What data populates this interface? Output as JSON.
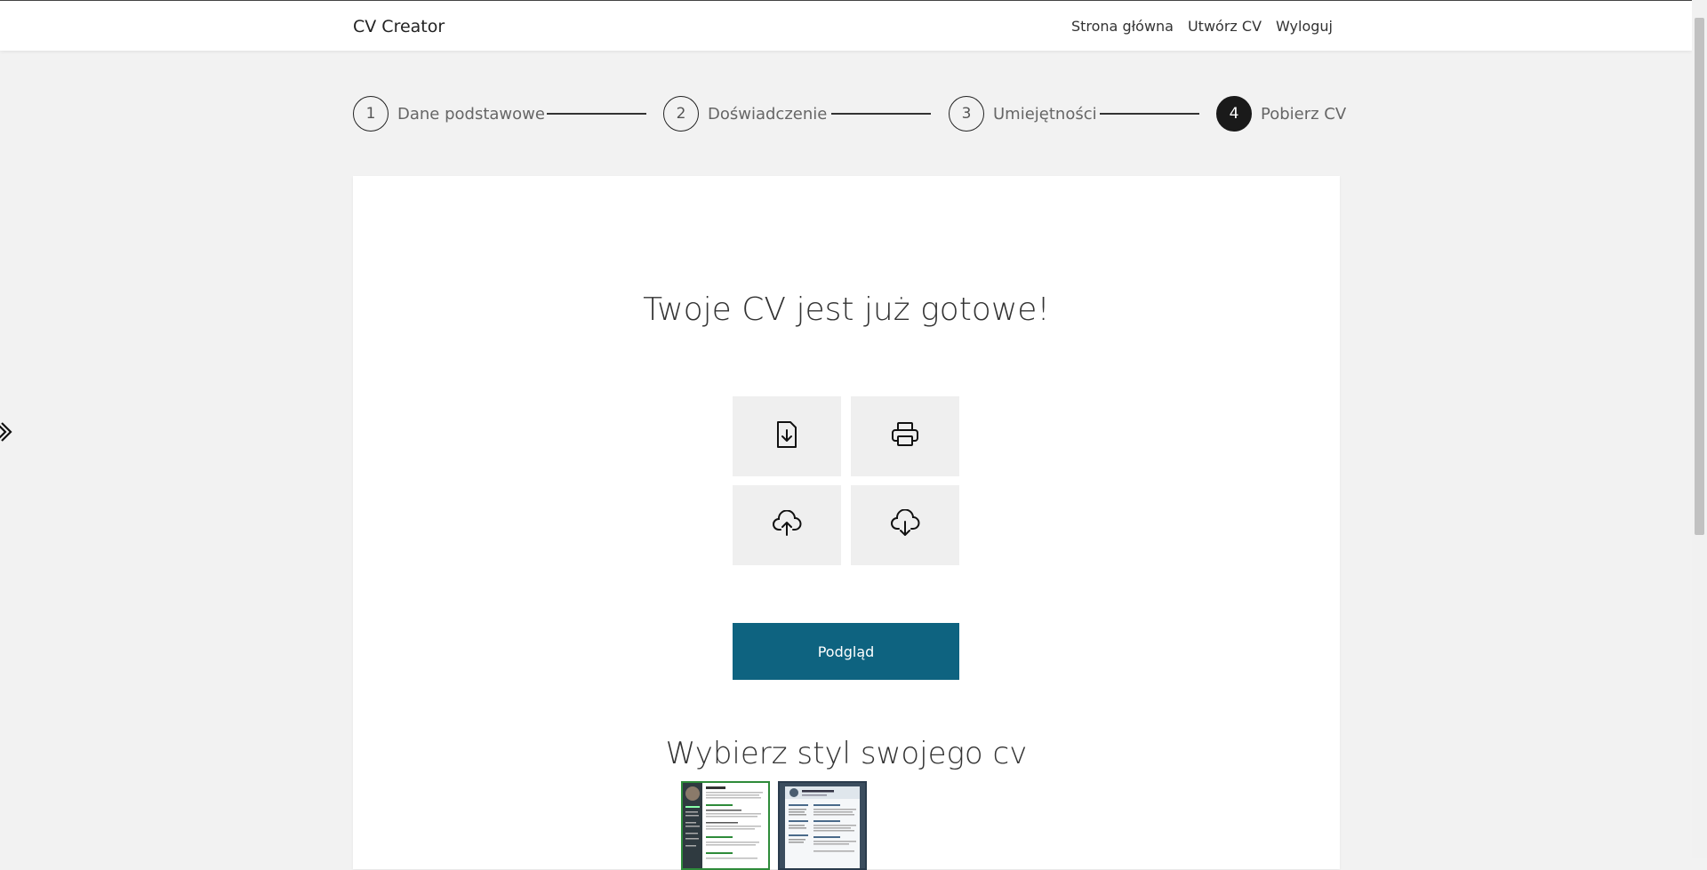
{
  "header": {
    "brand": "CV Creator",
    "nav": [
      "Strona główna",
      "Utwórz CV",
      "Wyloguj"
    ]
  },
  "stepper": {
    "steps": [
      {
        "number": "1",
        "label": "Dane podstawowe",
        "active": false
      },
      {
        "number": "2",
        "label": "Doświadczenie",
        "active": false
      },
      {
        "number": "3",
        "label": "Umiejętności",
        "active": false
      },
      {
        "number": "4",
        "label": "Pobierz CV",
        "active": true
      }
    ]
  },
  "main": {
    "heading": "Twoje CV jest już gotowe!",
    "actions": [
      "file-download-icon",
      "printer-icon",
      "cloud-upload-icon",
      "cloud-download-icon"
    ],
    "preview_label": "Podgląd",
    "style_heading": "Wybierz styl swojego cv"
  },
  "colors": {
    "accent": "#0e6380",
    "active_step": "#1a1a1a",
    "selected_template_border": "#2e8b3a"
  }
}
